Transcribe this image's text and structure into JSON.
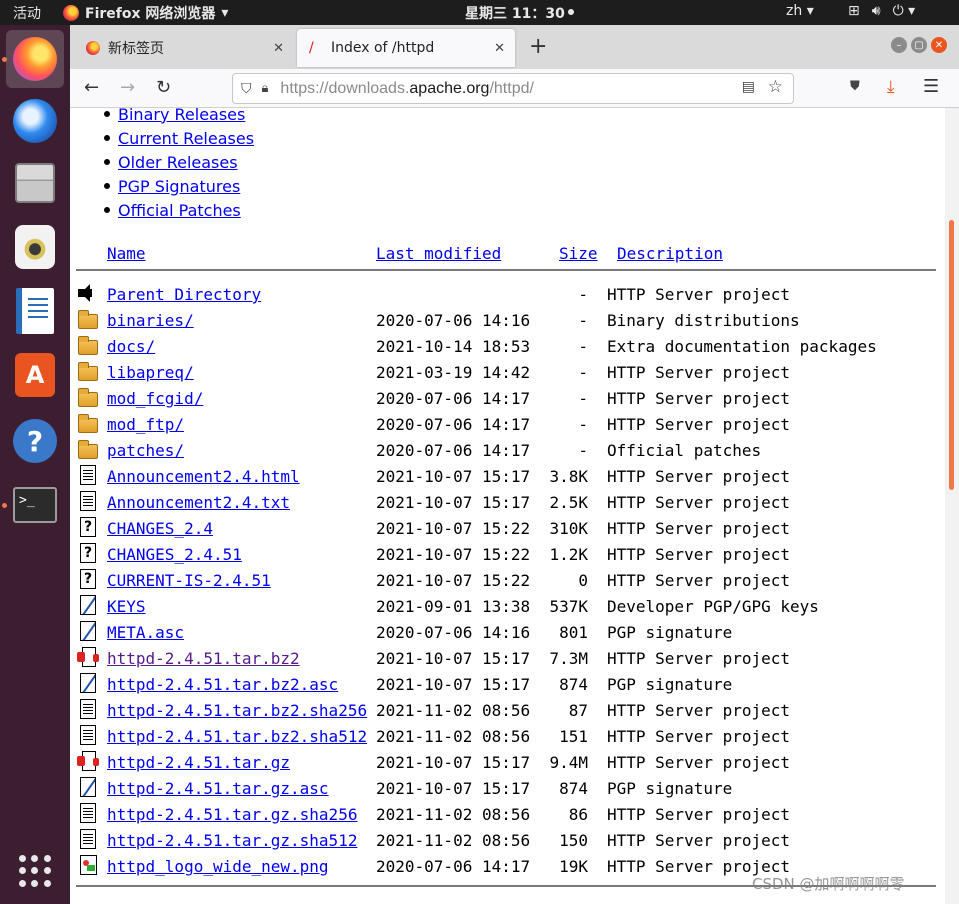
{
  "topbar": {
    "activities": "活动",
    "app_name": "Firefox 网络浏览器",
    "clock": "星期三 11：30",
    "language": "zh"
  },
  "dock": {
    "items": [
      "firefox",
      "thunderbird",
      "files",
      "rhythmbox",
      "libreoffice-writer",
      "ubuntu-software",
      "help",
      "terminal"
    ]
  },
  "browser": {
    "tabs": [
      {
        "label": "新标签页"
      },
      {
        "label": "Index of /httpd"
      }
    ],
    "url": {
      "scheme": "https://downloads.",
      "host": "apache.org",
      "path": "/httpd/"
    }
  },
  "page": {
    "toc": [
      "Binary Releases",
      "Current Releases",
      "Older Releases",
      "PGP Signatures",
      "Official Patches"
    ],
    "columns": {
      "name": "Name",
      "modified": "Last modified",
      "size": "Size",
      "description": "Description"
    },
    "rows": [
      {
        "icon": "back",
        "name": "Parent Directory",
        "date": "",
        "size": "-",
        "desc": "HTTP Server project"
      },
      {
        "icon": "folder",
        "name": "binaries/",
        "date": "2020-07-06 14:16",
        "size": "-",
        "desc": "Binary distributions"
      },
      {
        "icon": "folder",
        "name": "docs/",
        "date": "2021-10-14 18:53",
        "size": "-",
        "desc": "Extra documentation packages"
      },
      {
        "icon": "folder",
        "name": "libapreq/",
        "date": "2021-03-19 14:42",
        "size": "-",
        "desc": "HTTP Server project"
      },
      {
        "icon": "folder",
        "name": "mod_fcgid/",
        "date": "2020-07-06 14:17",
        "size": "-",
        "desc": "HTTP Server project"
      },
      {
        "icon": "folder",
        "name": "mod_ftp/",
        "date": "2020-07-06 14:17",
        "size": "-",
        "desc": "HTTP Server project"
      },
      {
        "icon": "folder",
        "name": "patches/",
        "date": "2020-07-06 14:17",
        "size": "-",
        "desc": "Official patches"
      },
      {
        "icon": "doc",
        "name": "Announcement2.4.html",
        "date": "2021-10-07 15:17",
        "size": "3.8K",
        "desc": "HTTP Server project"
      },
      {
        "icon": "doc",
        "name": "Announcement2.4.txt",
        "date": "2021-10-07 15:17",
        "size": "2.5K",
        "desc": "HTTP Server project"
      },
      {
        "icon": "unknown",
        "name": "CHANGES_2.4",
        "date": "2021-10-07 15:22",
        "size": "310K",
        "desc": "HTTP Server project"
      },
      {
        "icon": "unknown",
        "name": "CHANGES_2.4.51",
        "date": "2021-10-07 15:22",
        "size": "1.2K",
        "desc": "HTTP Server project"
      },
      {
        "icon": "unknown",
        "name": "CURRENT-IS-2.4.51",
        "date": "2021-10-07 15:22",
        "size": "0",
        "desc": "HTTP Server project"
      },
      {
        "icon": "key",
        "name": "KEYS",
        "date": "2021-09-01 13:38",
        "size": "537K",
        "desc": "Developer PGP/GPG keys"
      },
      {
        "icon": "key",
        "name": "META.asc",
        "date": "2020-07-06 14:16",
        "size": "801",
        "desc": "PGP signature"
      },
      {
        "icon": "archive",
        "name": "httpd-2.4.51.tar.bz2",
        "date": "2021-10-07 15:17",
        "size": "7.3M",
        "desc": "HTTP Server project",
        "visited": true
      },
      {
        "icon": "key",
        "name": "httpd-2.4.51.tar.bz2.asc",
        "date": "2021-10-07 15:17",
        "size": "874",
        "desc": "PGP signature"
      },
      {
        "icon": "doc",
        "name": "httpd-2.4.51.tar.bz2.sha256",
        "date": "2021-11-02 08:56",
        "size": "87",
        "desc": "HTTP Server project"
      },
      {
        "icon": "doc",
        "name": "httpd-2.4.51.tar.bz2.sha512",
        "date": "2021-11-02 08:56",
        "size": "151",
        "desc": "HTTP Server project"
      },
      {
        "icon": "archive",
        "name": "httpd-2.4.51.tar.gz",
        "date": "2021-10-07 15:17",
        "size": "9.4M",
        "desc": "HTTP Server project"
      },
      {
        "icon": "key",
        "name": "httpd-2.4.51.tar.gz.asc",
        "date": "2021-10-07 15:17",
        "size": "874",
        "desc": "PGP signature"
      },
      {
        "icon": "doc",
        "name": "httpd-2.4.51.tar.gz.sha256",
        "date": "2021-11-02 08:56",
        "size": "86",
        "desc": "HTTP Server project"
      },
      {
        "icon": "doc",
        "name": "httpd-2.4.51.tar.gz.sha512",
        "date": "2021-11-02 08:56",
        "size": "150",
        "desc": "HTTP Server project"
      },
      {
        "icon": "image",
        "name": "httpd_logo_wide_new.png",
        "date": "2020-07-06 14:17",
        "size": "19K",
        "desc": "HTTP Server project"
      }
    ]
  },
  "watermark": "CSDN @加啊啊啊啊零"
}
